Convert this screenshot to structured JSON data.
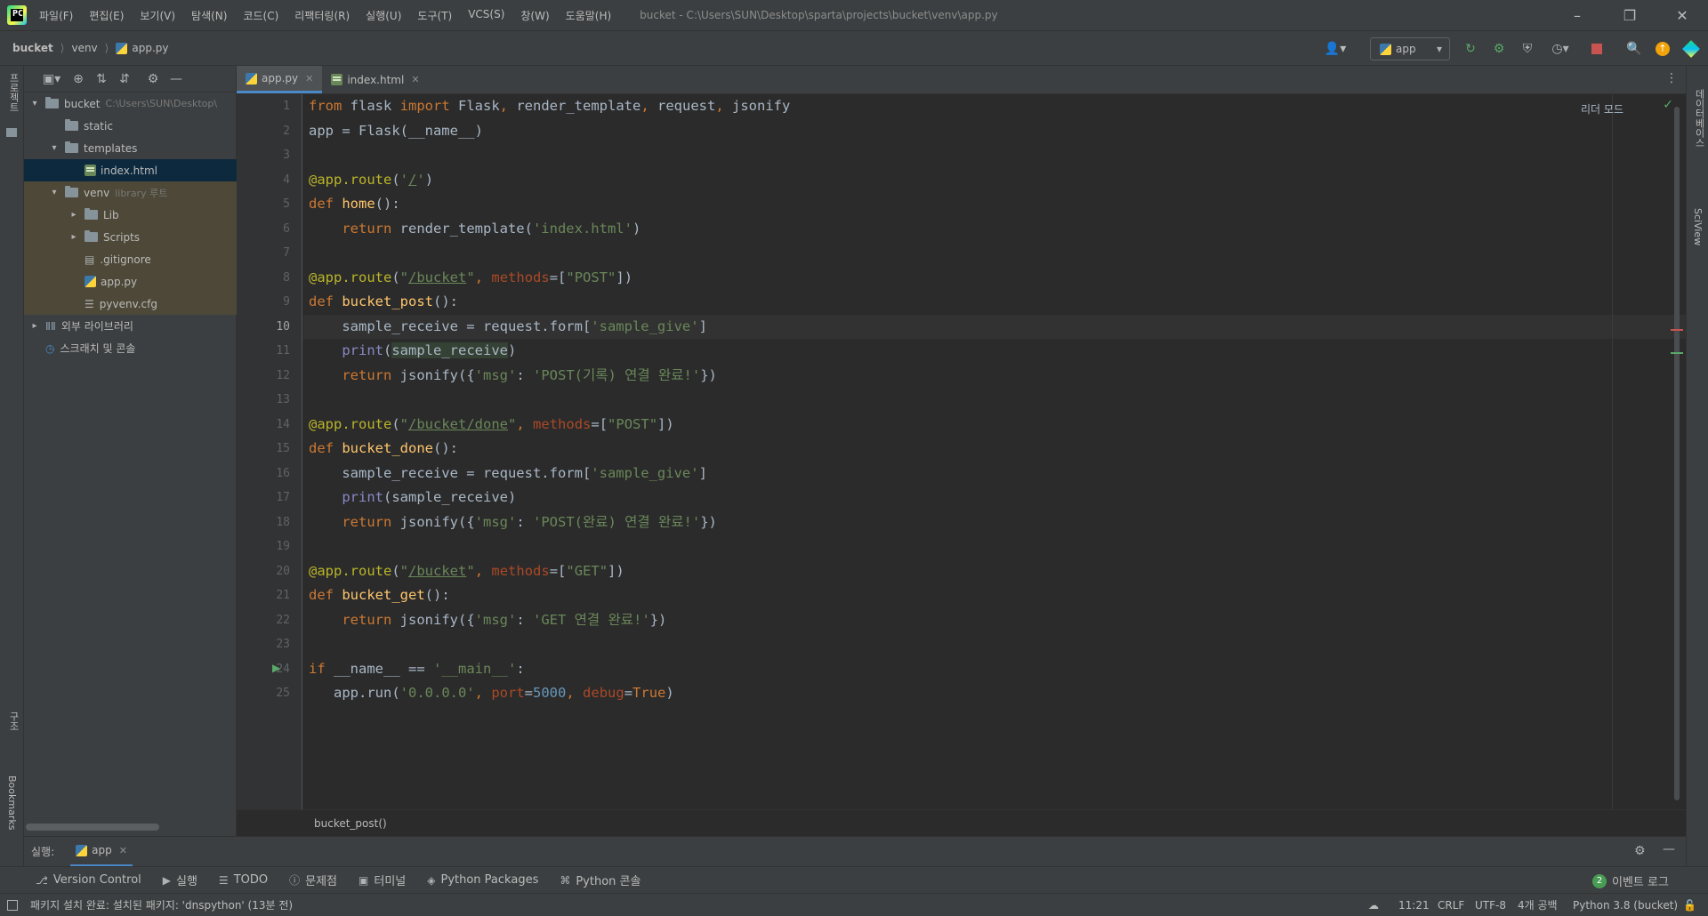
{
  "title_bar": {
    "menu": [
      "파일(F)",
      "편집(E)",
      "보기(V)",
      "탐색(N)",
      "코드(C)",
      "리팩터링(R)",
      "실행(U)",
      "도구(T)",
      "VCS(S)",
      "창(W)",
      "도움말(H)"
    ],
    "path": "bucket - C:\\Users\\SUN\\Desktop\\sparta\\projects\\bucket\\venv\\app.py"
  },
  "breadcrumb": {
    "project": "bucket",
    "folder": "venv",
    "file": "app.py"
  },
  "run_config": {
    "label": "app"
  },
  "left_strip": {
    "project_label": "프로젝트",
    "structure_label": "구조",
    "bookmarks_label": "Bookmarks"
  },
  "right_strip": {
    "database_label": "데이터베이스",
    "sciview_label": "SciView"
  },
  "project_tree": [
    {
      "label": "bucket",
      "detail": "C:\\Users\\SUN\\Desktop\\",
      "level": 0,
      "kind": "folder",
      "expanded": true
    },
    {
      "label": "static",
      "detail": "",
      "level": 1,
      "kind": "folder",
      "expanded": null
    },
    {
      "label": "templates",
      "detail": "",
      "level": 1,
      "kind": "folder",
      "expanded": true
    },
    {
      "label": "index.html",
      "detail": "",
      "level": 2,
      "kind": "html",
      "expanded": null,
      "selected": true
    },
    {
      "label": "venv",
      "detail": "library 루트",
      "level": 1,
      "kind": "folder",
      "expanded": true,
      "venv": true
    },
    {
      "label": "Lib",
      "detail": "",
      "level": 2,
      "kind": "folder",
      "expanded": false,
      "venv": true
    },
    {
      "label": "Scripts",
      "detail": "",
      "level": 2,
      "kind": "folder",
      "expanded": false,
      "venv": true
    },
    {
      "label": ".gitignore",
      "detail": "",
      "level": 2,
      "kind": "file",
      "expanded": null,
      "venv": true
    },
    {
      "label": "app.py",
      "detail": "",
      "level": 2,
      "kind": "py",
      "expanded": null,
      "venv": true
    },
    {
      "label": "pyvenv.cfg",
      "detail": "",
      "level": 2,
      "kind": "cfg",
      "expanded": null,
      "venv": true
    },
    {
      "label": "외부 라이브러리",
      "detail": "",
      "level": 0,
      "kind": "lib",
      "expanded": false
    },
    {
      "label": "스크래치 및 콘솔",
      "detail": "",
      "level": 0,
      "kind": "scratch",
      "expanded": null
    }
  ],
  "editor_tabs": [
    {
      "label": "app.py",
      "active": true,
      "kind": "py"
    },
    {
      "label": "index.html",
      "active": false,
      "kind": "html"
    }
  ],
  "editor": {
    "reader_mode": "리더 모드",
    "current_line": 10,
    "line_numbers": [
      "1",
      "2",
      "3",
      "4",
      "5",
      "6",
      "7",
      "8",
      "9",
      "10",
      "11",
      "12",
      "13",
      "14",
      "15",
      "16",
      "17",
      "18",
      "19",
      "20",
      "21",
      "22",
      "23",
      "24",
      "25"
    ],
    "breadcrumb_footer": "bucket_post()"
  },
  "run_bar": {
    "label": "실행:",
    "tab": "app"
  },
  "tool_tabs": [
    "Version Control",
    "실행",
    "TODO",
    "문제점",
    "터미널",
    "Python Packages",
    "Python 콘솔"
  ],
  "event_log": {
    "count": "2",
    "label": "이벤트 로그"
  },
  "status_bar": {
    "message": "패키지 설치 완료: 설치된 패키지: 'dnspython' (13분 전)",
    "position": "11:21",
    "line_ending": "CRLF",
    "encoding": "UTF-8",
    "indent": "4개 공백",
    "interpreter": "Python 3.8 (bucket)"
  }
}
